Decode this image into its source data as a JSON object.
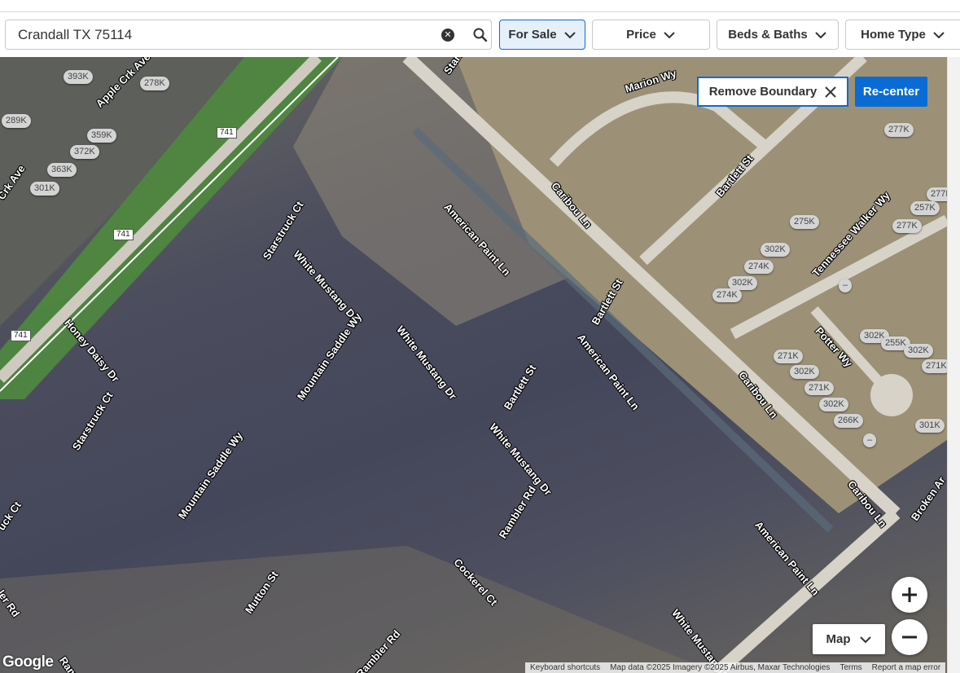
{
  "search": {
    "value": "Crandall TX 75114",
    "placeholder": ""
  },
  "filters": [
    {
      "label": "For Sale",
      "active": true
    },
    {
      "label": "Price"
    },
    {
      "label": "Beds & Baths"
    },
    {
      "label": "Home Type"
    }
  ],
  "map_controls": {
    "remove_boundary": "Remove Boundary",
    "recenter": "Re-center",
    "map_type": "Map",
    "zoom_in": "+",
    "zoom_out": "−"
  },
  "price_pins": [
    "393K",
    "278K",
    "289K",
    "359K",
    "372K",
    "363K",
    "301K",
    "277K",
    "277K",
    "257K",
    "277K",
    "275K",
    "302K",
    "274K",
    "302K",
    "274K",
    "–",
    "302K",
    "255K",
    "302K",
    "271K",
    "271K",
    "302K",
    "271K",
    "302K",
    "266K",
    "301K",
    "–",
    "–"
  ],
  "streets": [
    "Apple Crk Ave",
    "Starstruck Ct",
    "White Mustang Dr",
    "American Paint Ln",
    "Marion Wy",
    "Bartlett St",
    "Caribou Ln",
    "Tennessee Walker Wy",
    "Honey Daisy Dr",
    "Mountain Saddle Wy",
    "White Mustang Dr",
    "Bartlett St",
    "American Paint Ln",
    "Potter Wy",
    "Caribou Ln",
    "Starstruck Ct",
    "Mountain Saddle Wy",
    "White Mustang Dr",
    "Rambler Rd",
    "Caribou Ln",
    "Cockerel Ct",
    "Mutton St",
    "American Paint Ln",
    "White Mustang Dr",
    "Rambler Rd",
    "Broken Ar",
    "Bartlett St",
    "Crk Ave",
    "uck Ct",
    "ler Rd",
    "Rambl",
    "Starst"
  ],
  "highway_labels": [
    "741",
    "741",
    "741"
  ],
  "attribution": [
    "Keyboard shortcuts",
    "Map data ©2025 Imagery ©2025 Airbus, Maxar Technologies",
    "Terms",
    "Report a map error"
  ],
  "google_logo": "Google"
}
